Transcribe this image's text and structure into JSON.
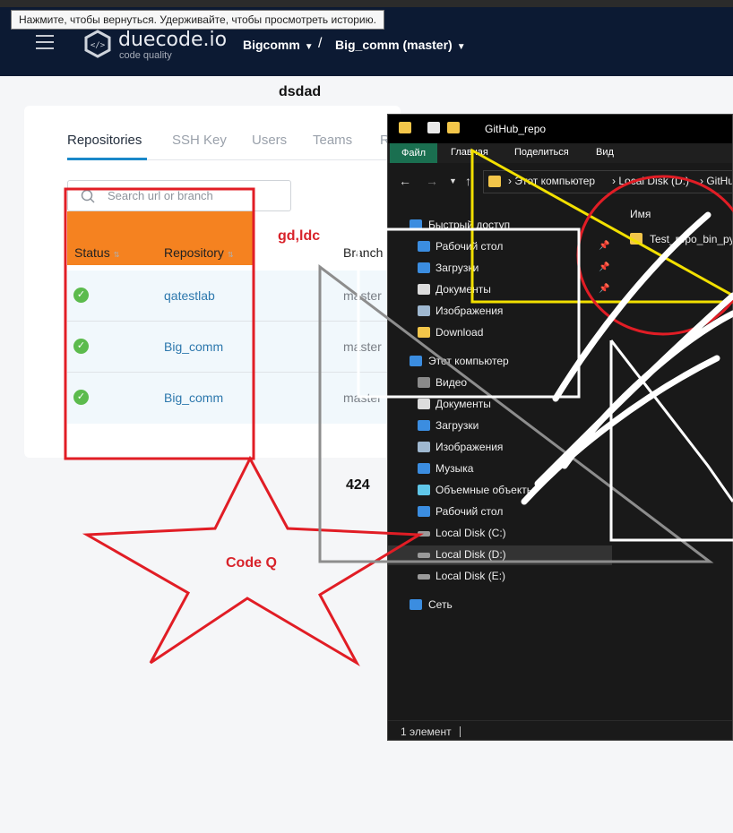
{
  "tooltip": "Нажмите, чтобы вернуться. Удерживайте, чтобы просмотреть историю.",
  "header": {
    "logo_name": "duecode.io",
    "logo_sub": "code quality",
    "breadcrumb_org": "Bigcomm",
    "breadcrumb_sep": "/",
    "breadcrumb_repo": "Big_comm (master)"
  },
  "page_title": "dsdad",
  "tabs": [
    "Repositories",
    "SSH Key",
    "Users",
    "Teams",
    "R"
  ],
  "search": {
    "placeholder": "Search url or branch"
  },
  "table": {
    "col_status": "Status",
    "col_repository": "Repository",
    "col_branch": "Branch",
    "rows": [
      {
        "repository": "qatestlab",
        "branch": "master"
      },
      {
        "repository": "Big_comm",
        "branch": "master"
      },
      {
        "repository": "Big_comm",
        "branch": "master"
      }
    ]
  },
  "annotations": {
    "gdldc": "gd,ldc",
    "number": "424",
    "star_label": "Code Q"
  },
  "explorer": {
    "title": "GitHub_repo",
    "ribbon": {
      "file": "Файл",
      "home": "Главная",
      "share": "Поделиться",
      "view": "Вид"
    },
    "address": [
      "Этот компьютер",
      "Local Disk (D:)",
      "GitHub"
    ],
    "content_header": "Имя",
    "file_name": "Test_repo_bin_py",
    "nav": [
      "Быстрый доступ",
      "Рабочий стол",
      "Загрузки",
      "Документы",
      "Изображения",
      "Download",
      "Этот компьютер",
      "Видео",
      "Документы",
      "Загрузки",
      "Изображения",
      "Музыка",
      "Объемные объекты",
      "Рабочий стол",
      "Local Disk (C:)",
      "Local Disk (D:)",
      "Local Disk (E:)",
      "Сеть"
    ],
    "status": "1 элемент"
  },
  "colors": {
    "header_bg": "#0c1a33",
    "accent": "#1a88c9",
    "orange": "#f58220",
    "annotation_red": "#d8222a",
    "success": "#5cbb4d"
  }
}
